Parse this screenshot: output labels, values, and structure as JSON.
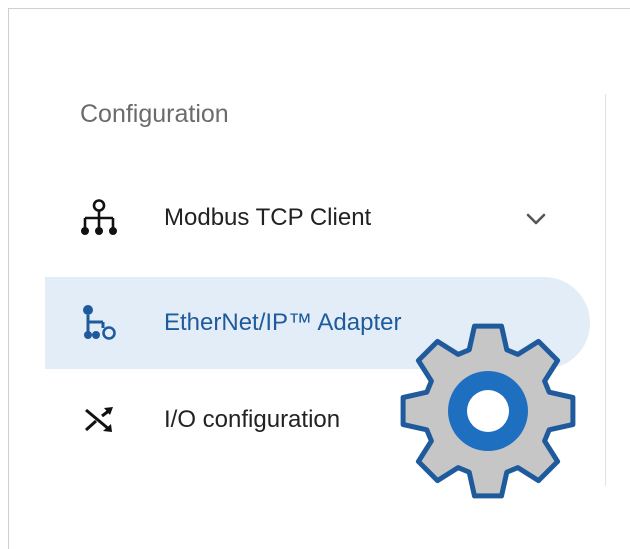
{
  "section": {
    "title": "Configuration"
  },
  "nav": {
    "items": [
      {
        "label": "Modbus TCP Client",
        "icon": "network-tree-icon",
        "expandable": true,
        "active": false
      },
      {
        "label": "EtherNet/IP™ Adapter",
        "icon": "ethernet-ip-adapter-icon",
        "active": true
      },
      {
        "label": "I/O configuration",
        "icon": "shuffle-arrows-icon",
        "active": false
      }
    ],
    "expand_icon": "chevron-down-icon"
  },
  "overlay": {
    "icon": "gear-icon"
  },
  "colors": {
    "active_bg": "#e3edf7",
    "active_text": "#1f5b9c",
    "gear_fill": "#c6c6c6",
    "gear_stroke": "#1f5b9c",
    "gear_hub": "#1e6fbf"
  }
}
